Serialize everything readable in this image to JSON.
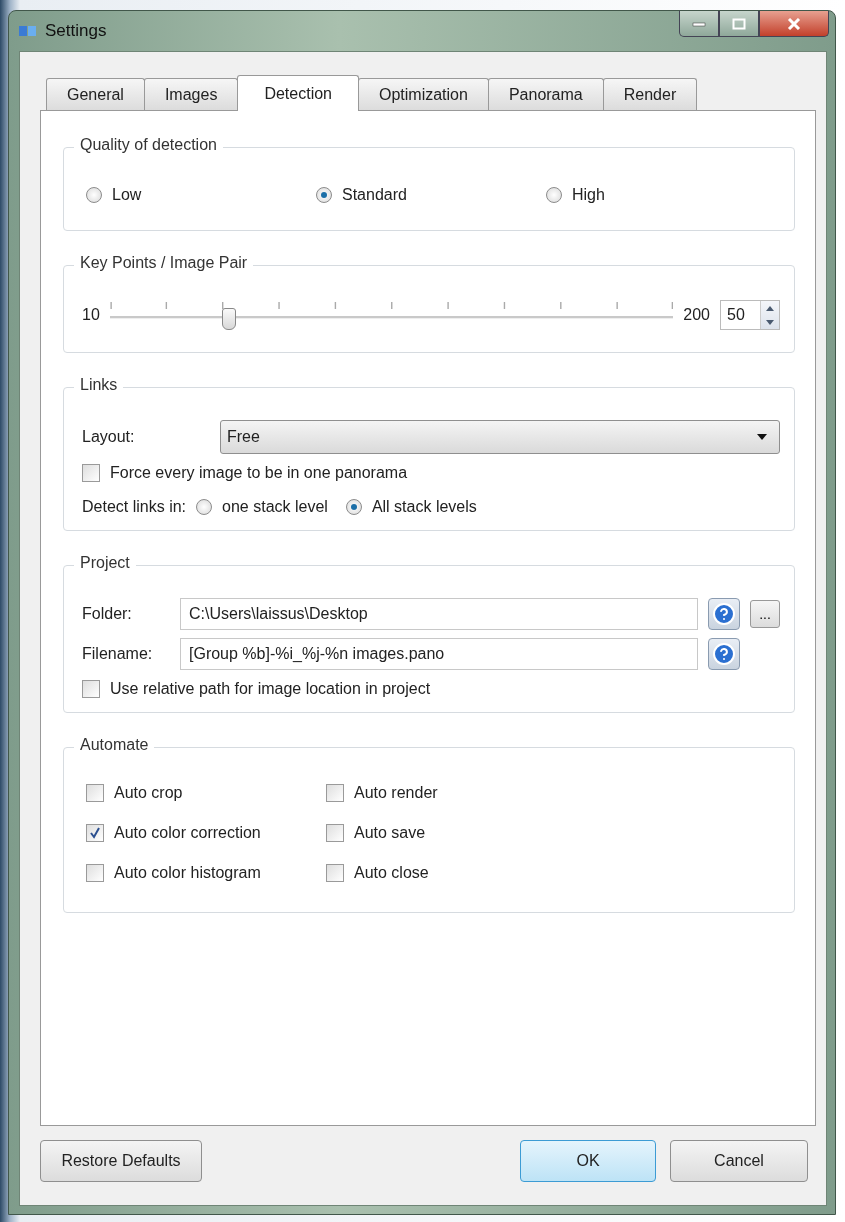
{
  "window": {
    "title": "Settings"
  },
  "tabs": [
    {
      "label": "General",
      "selected": false
    },
    {
      "label": "Images",
      "selected": false
    },
    {
      "label": "Detection",
      "selected": true
    },
    {
      "label": "Optimization",
      "selected": false
    },
    {
      "label": "Panorama",
      "selected": false
    },
    {
      "label": "Render",
      "selected": false
    }
  ],
  "quality": {
    "title": "Quality of detection",
    "options": [
      {
        "label": "Low",
        "selected": false
      },
      {
        "label": "Standard",
        "selected": true
      },
      {
        "label": "High",
        "selected": false
      }
    ]
  },
  "key_points": {
    "title": "Key Points / Image Pair",
    "min": "10",
    "max": "200",
    "level": 0.21,
    "value": "50"
  },
  "links": {
    "title": "Links",
    "layout_label": "Layout:",
    "layout_value": "Free",
    "force": {
      "label": "Force every image to be in one panorama",
      "checked": false
    },
    "detect_label": "Detect links in:",
    "detect_options": [
      {
        "label": "one stack level",
        "selected": false
      },
      {
        "label": "All stack levels",
        "selected": true
      }
    ]
  },
  "project": {
    "title": "Project",
    "folder_label": "Folder:",
    "folder_value": "C:\\Users\\laissus\\Desktop",
    "browse": "...",
    "filename_label": "Filename:",
    "filename_value": "[Group %b]-%i_%j-%n images.pano",
    "relative": {
      "label": "Use relative path for image location in project",
      "checked": false
    }
  },
  "automate": {
    "title": "Automate",
    "options": [
      {
        "label": "Auto crop",
        "checked": false
      },
      {
        "label": "Auto render",
        "checked": false
      },
      {
        "label": "Auto color correction",
        "checked": true
      },
      {
        "label": "Auto save",
        "checked": false
      },
      {
        "label": "Auto color histogram",
        "checked": false
      },
      {
        "label": "Auto close",
        "checked": false
      }
    ]
  },
  "buttons": {
    "restore": "Restore Defaults",
    "ok": "OK",
    "cancel": "Cancel"
  }
}
